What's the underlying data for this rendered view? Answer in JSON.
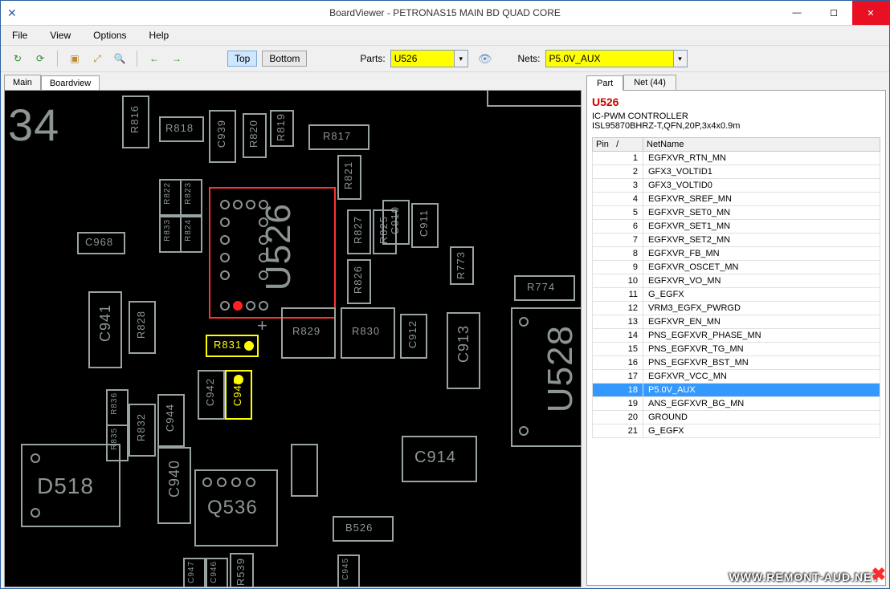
{
  "title": "BoardViewer  -  PETRONAS15 MAIN BD QUAD CORE",
  "menu": {
    "file": "File",
    "view": "View",
    "options": "Options",
    "help": "Help"
  },
  "toolbar": {
    "top": "Top",
    "bottom": "Bottom",
    "parts_label": "Parts:",
    "parts_value": "U526",
    "nets_label": "Nets:",
    "nets_value": "P5.0V_AUX"
  },
  "left_tabs": {
    "main": "Main",
    "boardview": "Boardview"
  },
  "right_tabs": {
    "part": "Part",
    "net": "Net (44)"
  },
  "part": {
    "name": "U526",
    "desc1": "IC-PWM CONTROLLER",
    "desc2": "ISL95870BHRZ-T,QFN,20P,3x4x0.9m",
    "col_pin": "Pin",
    "col_net": "NetName",
    "rows": [
      {
        "pin": "1",
        "net": "EGFXVR_RTN_MN"
      },
      {
        "pin": "2",
        "net": "GFX3_VOLTID1"
      },
      {
        "pin": "3",
        "net": "GFX3_VOLTID0"
      },
      {
        "pin": "4",
        "net": "EGFXVR_SREF_MN"
      },
      {
        "pin": "5",
        "net": "EGFXVR_SET0_MN"
      },
      {
        "pin": "6",
        "net": "EGFXVR_SET1_MN"
      },
      {
        "pin": "7",
        "net": "EGFXVR_SET2_MN"
      },
      {
        "pin": "8",
        "net": "EGFXVR_FB_MN"
      },
      {
        "pin": "9",
        "net": "EGFXVR_OSCET_MN"
      },
      {
        "pin": "10",
        "net": "EGFXVR_VO_MN"
      },
      {
        "pin": "11",
        "net": "G_EGFX"
      },
      {
        "pin": "12",
        "net": "VRM3_EGFX_PWRGD"
      },
      {
        "pin": "13",
        "net": "EGFXVR_EN_MN"
      },
      {
        "pin": "14",
        "net": "PNS_EGFXVR_PHASE_MN"
      },
      {
        "pin": "15",
        "net": "PNS_EGFXVR_TG_MN"
      },
      {
        "pin": "16",
        "net": "PNS_EGFXVR_BST_MN"
      },
      {
        "pin": "17",
        "net": "EGFXVR_VCC_MN"
      },
      {
        "pin": "18",
        "net": "P5.0V_AUX",
        "sel": true
      },
      {
        "pin": "19",
        "net": "ANS_EGFXVR_BG_MN"
      },
      {
        "pin": "20",
        "net": "GROUND"
      },
      {
        "pin": "21",
        "net": "G_EGFX"
      }
    ]
  },
  "board": {
    "bignum": "34",
    "components": {
      "U526": "U526",
      "U528": "U528",
      "D518": "D518",
      "Q536": "Q536",
      "C914": "C914",
      "C913": "C913",
      "C912": "C912",
      "C911": "C911",
      "C910": "C910",
      "C940": "C940",
      "C941": "C941",
      "C942": "C942",
      "C943": "C943",
      "C944": "C944",
      "C945": "C945",
      "C946": "C946",
      "C947": "C947",
      "C968": "C968",
      "C939": "C939",
      "R816": "R816",
      "R817": "R817",
      "R818": "R818",
      "R819": "R819",
      "R820": "R820",
      "R821": "R821",
      "R822": "R822",
      "R823": "R823",
      "R824": "R824",
      "R825": "R825",
      "R826": "R826",
      "R827": "R827",
      "R828": "R828",
      "R829": "R829",
      "R830": "R830",
      "R831": "R831",
      "R832": "R832",
      "R833": "R833",
      "R835": "R835",
      "R836": "R836",
      "R773": "R773",
      "R774": "R774",
      "B526": "B526",
      "R539": "R539"
    }
  },
  "watermark": "WWW.REMONT-AUD.NET"
}
